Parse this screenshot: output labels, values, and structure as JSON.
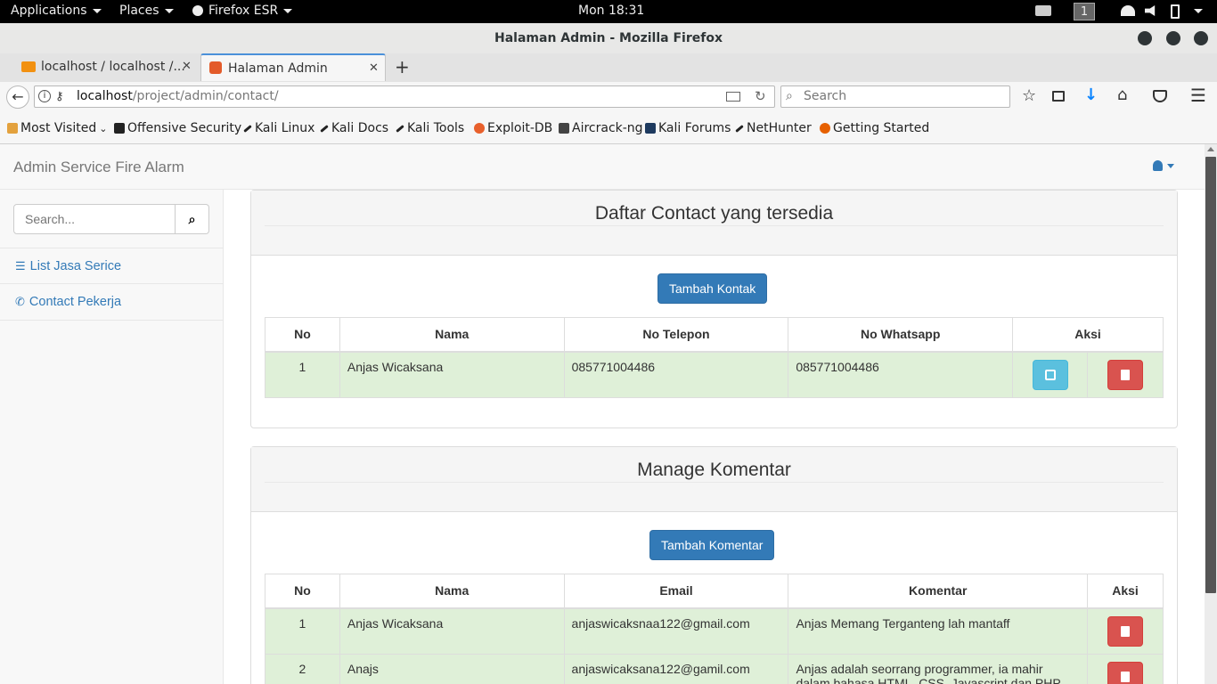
{
  "topbar": {
    "applications": "Applications",
    "places": "Places",
    "firefox": "Firefox ESR",
    "clock": "Mon 18:31",
    "workspace": "1"
  },
  "window": {
    "title": "Halaman Admin - Mozilla Firefox"
  },
  "tabs": [
    {
      "label": "localhost / localhost /..."
    },
    {
      "label": "Halaman Admin"
    }
  ],
  "navbar": {
    "url_host": "localhost",
    "url_path": "/project/admin/contact/",
    "search_placeholder": "Search"
  },
  "bookmarks": [
    "Most Visited",
    "Offensive Security",
    "Kali Linux",
    "Kali Docs",
    "Kali Tools",
    "Exploit-DB",
    "Aircrack-ng",
    "Kali Forums",
    "NetHunter",
    "Getting Started"
  ],
  "app": {
    "brand": "Admin Service Fire Alarm"
  },
  "sidebar": {
    "search_placeholder": "Search...",
    "items": [
      {
        "label": "List Jasa Serice"
      },
      {
        "label": "Contact Pekerja"
      }
    ]
  },
  "contact_panel": {
    "title": "Daftar Contact yang tersedia",
    "add_button": "Tambah Kontak",
    "headers": [
      "No",
      "Nama",
      "No Telepon",
      "No Whatsapp",
      "Aksi"
    ],
    "rows": [
      {
        "no": "1",
        "nama": "Anjas Wicaksana",
        "telepon": "085771004486",
        "whatsapp": "085771004486"
      }
    ]
  },
  "comment_panel": {
    "title": "Manage Komentar",
    "add_button": "Tambah Komentar",
    "headers": [
      "No",
      "Nama",
      "Email",
      "Komentar",
      "Aksi"
    ],
    "rows": [
      {
        "no": "1",
        "nama": "Anjas Wicaksana",
        "email": "anjaswicaksnaa122@gmail.com",
        "komentar": "Anjas Memang Terganteng lah mantaff"
      },
      {
        "no": "2",
        "nama": "Anajs",
        "email": "anjaswicaksana122@gamil.com",
        "komentar": "Anjas adalah seorrang programmer, ia mahir dalam bahasa HTML, CSS, Javascript dan PHP"
      }
    ]
  },
  "colors": {
    "primary": "#337ab7",
    "info": "#5bc0de",
    "danger": "#d9534f",
    "success_row": "#dff0d8"
  }
}
